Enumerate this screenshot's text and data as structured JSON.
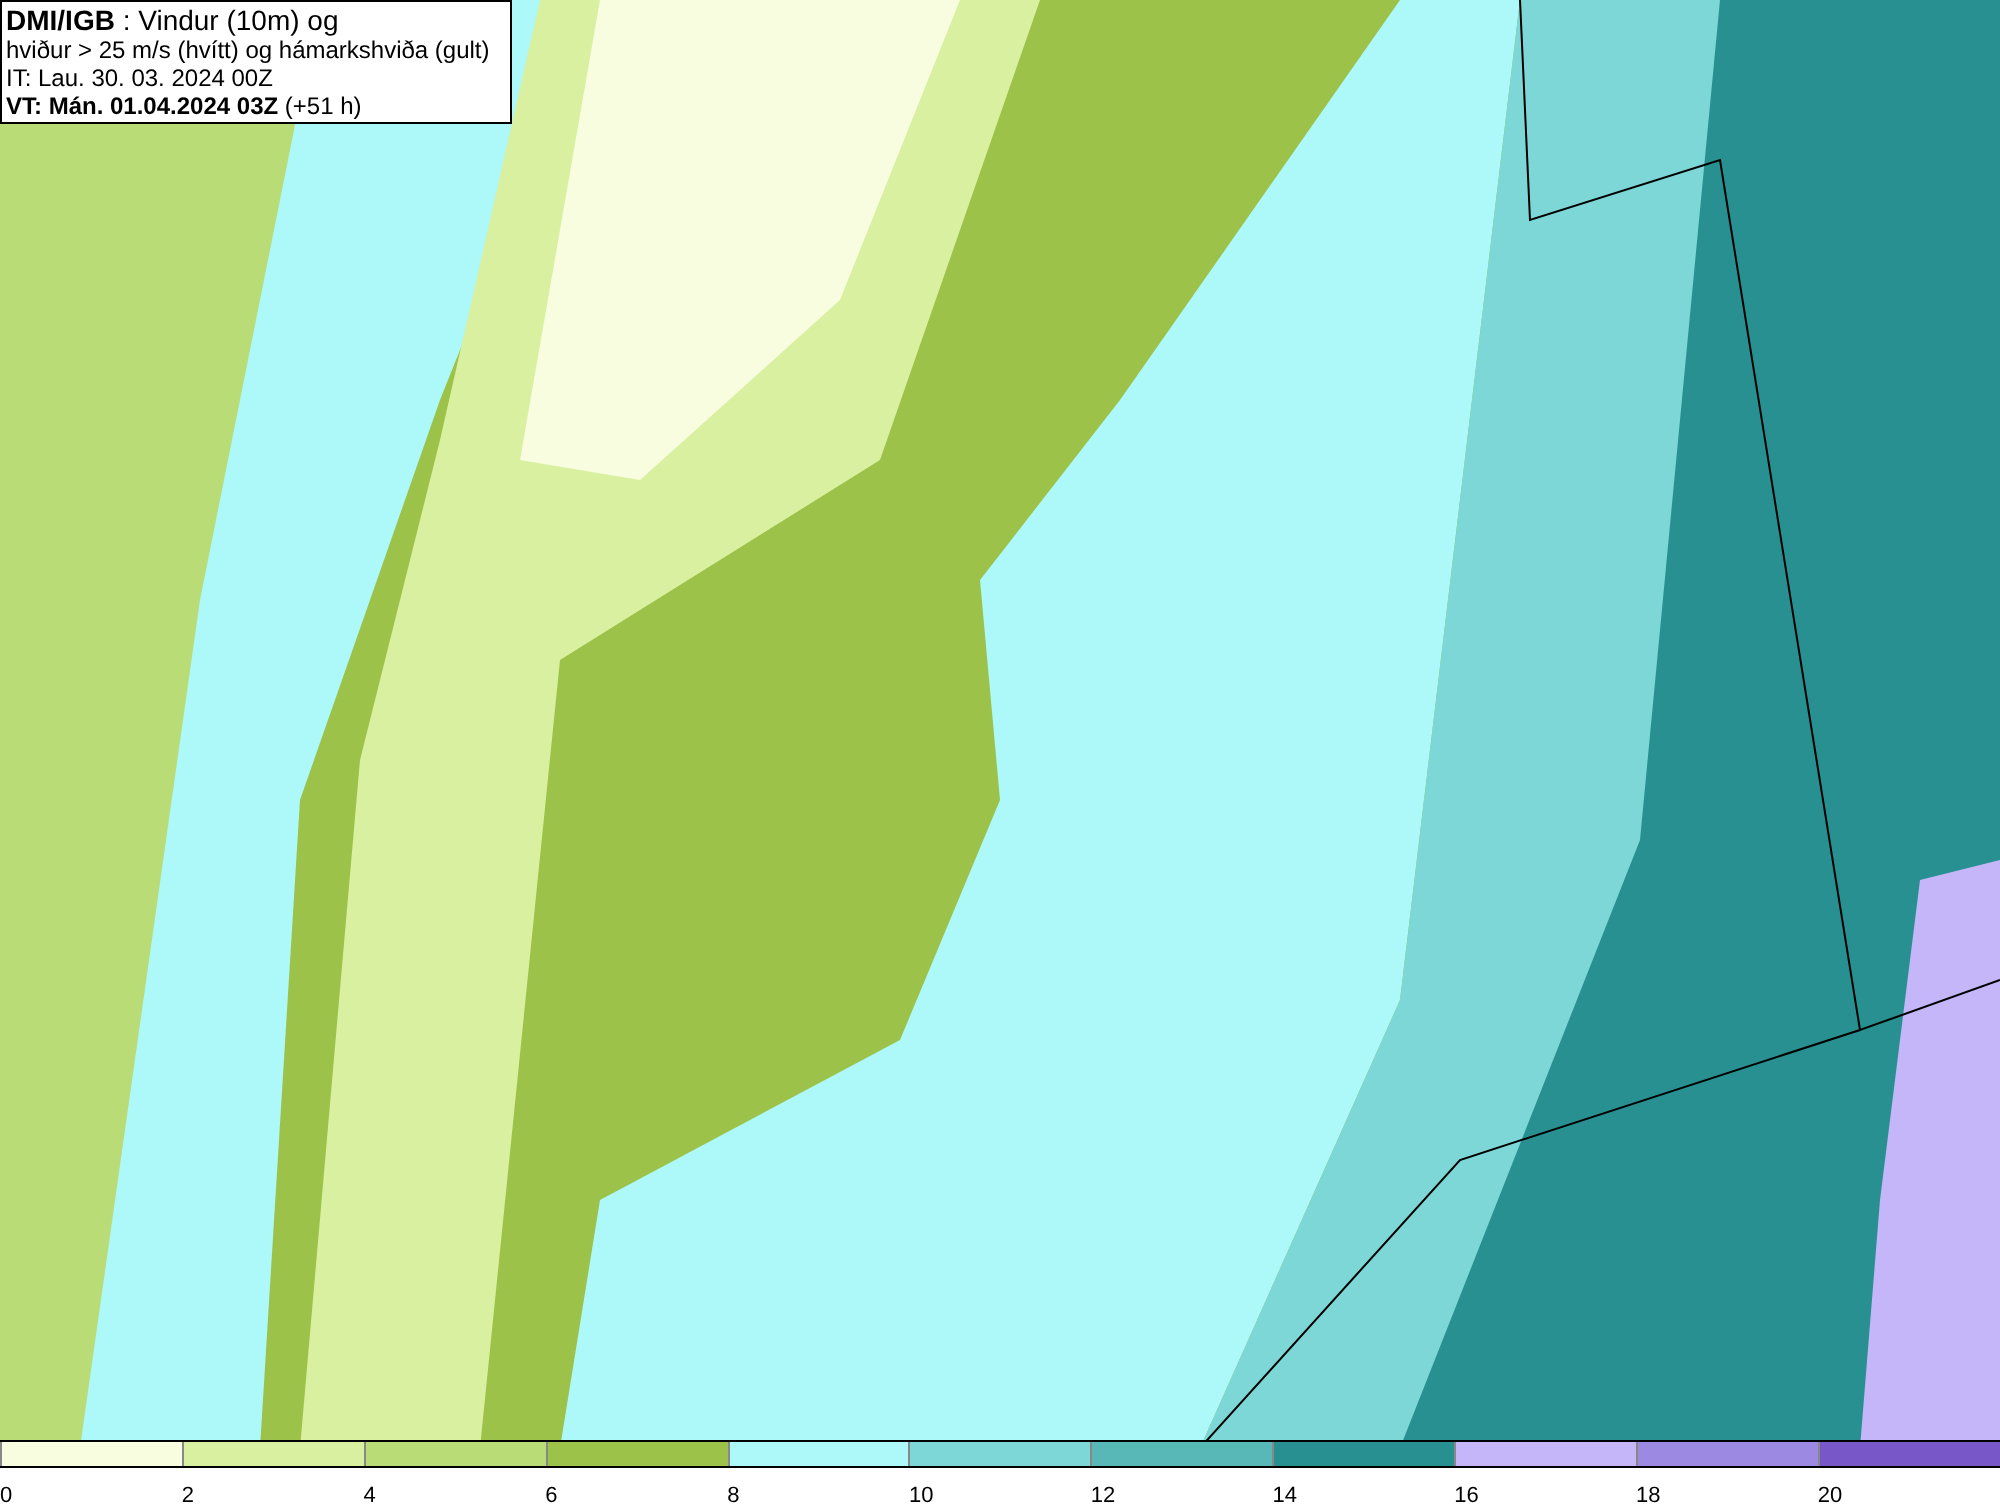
{
  "title_box": {
    "lines": [
      "**DMI/IGB** : Vindur (10m) og",
      "hviður > 25 m/s (hvítt) og hámarkshviða (gult)",
      "IT: Lau. 30. 03. 2024 00Z",
      "**VT: Mán. 01.04.2024 03Z** (+51 h)"
    ]
  },
  "legend": [
    {
      "label": "0",
      "color": "#f8fde0"
    },
    {
      "label": "2",
      "color": "#d9f0a0"
    },
    {
      "label": "4",
      "color": "#b9dc76"
    },
    {
      "label": "6",
      "color": "#9cc24a"
    },
    {
      "label": "8",
      "color": "#adf8f8"
    },
    {
      "label": "10",
      "color": "#7ed7d7"
    },
    {
      "label": "12",
      "color": "#58b8b8"
    },
    {
      "label": "14",
      "color": "#289090"
    },
    {
      "label": "16",
      "color": "#c4b6f8"
    },
    {
      "label": "18",
      "color": "#9c8ae2"
    },
    {
      "label": "20",
      "color": "#7858c8"
    }
  ]
}
